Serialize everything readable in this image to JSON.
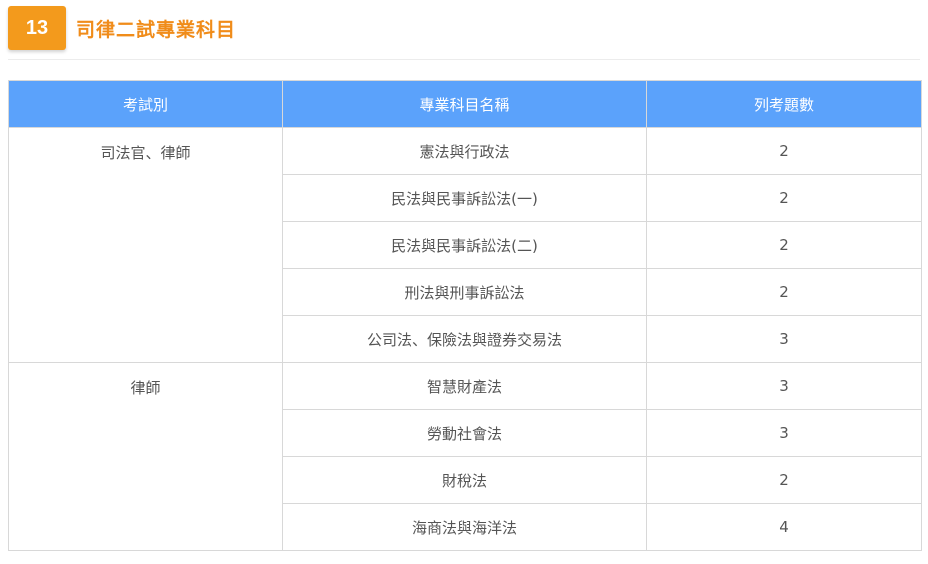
{
  "header": {
    "number": "13",
    "title": "司律二試專業科目"
  },
  "table": {
    "columns": [
      "考試別",
      "專業科目名稱",
      "列考題數"
    ],
    "groups": [
      {
        "exam": "司法官、律師",
        "rows": [
          {
            "subject": "憲法與行政法",
            "count": "2"
          },
          {
            "subject": "民法與民事訴訟法(一)",
            "count": "2"
          },
          {
            "subject": "民法與民事訴訟法(二)",
            "count": "2"
          },
          {
            "subject": "刑法與刑事訴訟法",
            "count": "2"
          },
          {
            "subject": "公司法、保險法與證券交易法",
            "count": "3"
          }
        ]
      },
      {
        "exam": "律師",
        "rows": [
          {
            "subject": "智慧財產法",
            "count": "3"
          },
          {
            "subject": "勞動社會法",
            "count": "3"
          },
          {
            "subject": "財稅法",
            "count": "2"
          },
          {
            "subject": "海商法與海洋法",
            "count": "4"
          }
        ]
      }
    ]
  },
  "colors": {
    "accent": "#f39a1c",
    "title": "#f08c1a",
    "header_bg": "#5ba2fb"
  }
}
